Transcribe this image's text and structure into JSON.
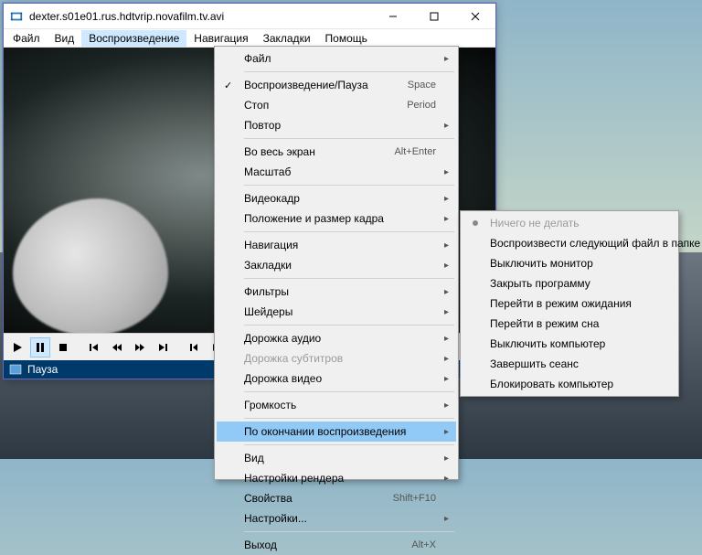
{
  "window": {
    "title": "dexter.s01e01.rus.hdtvrip.novafilm.tv.avi"
  },
  "menubar": {
    "items": [
      "Файл",
      "Вид",
      "Воспроизведение",
      "Навигация",
      "Закладки",
      "Помощь"
    ],
    "activeIndex": 2
  },
  "status": {
    "label": "Пауза"
  },
  "dropdown": {
    "items": [
      {
        "type": "item",
        "label": "Файл",
        "sub": true
      },
      {
        "type": "sep"
      },
      {
        "type": "item",
        "label": "Воспроизведение/Пауза",
        "shortcut": "Space",
        "checked": true
      },
      {
        "type": "item",
        "label": "Стоп",
        "shortcut": "Period"
      },
      {
        "type": "item",
        "label": "Повтор",
        "sub": true
      },
      {
        "type": "sep"
      },
      {
        "type": "item",
        "label": "Во весь экран",
        "shortcut": "Alt+Enter"
      },
      {
        "type": "item",
        "label": "Масштаб",
        "sub": true
      },
      {
        "type": "sep"
      },
      {
        "type": "item",
        "label": "Видеокадр",
        "sub": true
      },
      {
        "type": "item",
        "label": "Положение и размер кадра",
        "sub": true
      },
      {
        "type": "sep"
      },
      {
        "type": "item",
        "label": "Навигация",
        "sub": true
      },
      {
        "type": "item",
        "label": "Закладки",
        "sub": true
      },
      {
        "type": "sep"
      },
      {
        "type": "item",
        "label": "Фильтры",
        "sub": true
      },
      {
        "type": "item",
        "label": "Шейдеры",
        "sub": true
      },
      {
        "type": "sep"
      },
      {
        "type": "item",
        "label": "Дорожка аудио",
        "sub": true
      },
      {
        "type": "item",
        "label": "Дорожка субтитров",
        "sub": true,
        "disabled": true
      },
      {
        "type": "item",
        "label": "Дорожка видео",
        "sub": true
      },
      {
        "type": "sep"
      },
      {
        "type": "item",
        "label": "Громкость",
        "sub": true
      },
      {
        "type": "sep"
      },
      {
        "type": "item",
        "label": "По окончании воспроизведения",
        "sub": true,
        "highlighted": true
      },
      {
        "type": "sep"
      },
      {
        "type": "item",
        "label": "Вид",
        "sub": true
      },
      {
        "type": "item",
        "label": "Настройки рендера",
        "sub": true
      },
      {
        "type": "item",
        "label": "Свойства",
        "shortcut": "Shift+F10"
      },
      {
        "type": "item",
        "label": "Настройки...",
        "sub": true
      },
      {
        "type": "sep"
      },
      {
        "type": "item",
        "label": "Выход",
        "shortcut": "Alt+X"
      }
    ]
  },
  "submenu": {
    "items": [
      {
        "label": "Ничего не делать",
        "radio": true,
        "disabled": true
      },
      {
        "label": "Воспроизвести следующий файл в папке"
      },
      {
        "label": "Выключить монитор"
      },
      {
        "label": "Закрыть программу"
      },
      {
        "label": "Перейти в режим ожидания"
      },
      {
        "label": "Перейти в режим сна"
      },
      {
        "label": "Выключить компьютер"
      },
      {
        "label": "Завершить сеанс"
      },
      {
        "label": "Блокировать компьютер"
      }
    ]
  }
}
